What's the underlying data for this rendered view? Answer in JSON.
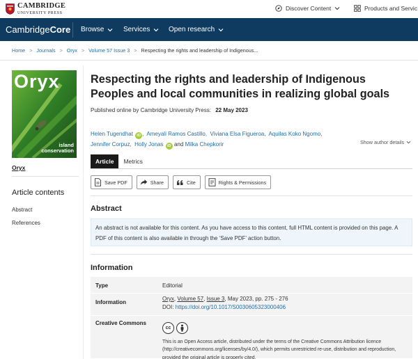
{
  "topbar": {
    "logo_line1": "CAMBRIDGE",
    "logo_line2": "UNIVERSITY PRESS",
    "discover_label": "Discover Content",
    "products_label": "Products and Servic"
  },
  "navbar": {
    "brand_prefix": "Cambridge",
    "brand_suffix": "Core",
    "items": [
      {
        "label": "Browse"
      },
      {
        "label": "Services"
      },
      {
        "label": "Open research"
      }
    ]
  },
  "breadcrumb": {
    "items": [
      "Home",
      "Journals",
      "Oryx",
      "Volume 57 Issue 3"
    ],
    "current": "Respecting the rights and leadership of Indigenous..."
  },
  "sidebar": {
    "cover_title": "Oryx",
    "cover_sub1": "island",
    "cover_sub2": "conservation",
    "journal_link": "Oryx",
    "contents_heading": "Article contents",
    "contents_items": [
      "Abstract",
      "References"
    ]
  },
  "article": {
    "title": "Respecting the rights and leadership of Indigenous Peoples and local communities in realizing global goals",
    "published_prefix": "Published online by Cambridge University Press:",
    "published_date": "22 May 2023",
    "authors": [
      "Helen Tugendhat",
      "Ameyali Ramos Castillo",
      "Viviana Elsa Figueroa",
      "Aquilas Koko Ngomo",
      "Jennifer Corpuz",
      "Holly Jonas",
      "Milka Chepkorir"
    ],
    "and_word": "and",
    "show_details": "Show author details"
  },
  "tabs": [
    {
      "label": "Article"
    },
    {
      "label": "Metrics"
    }
  ],
  "actions": [
    {
      "label": "Save PDF",
      "icon": "pdf-icon"
    },
    {
      "label": "Share",
      "icon": "share-icon"
    },
    {
      "label": "Cite",
      "icon": "quote-icon"
    },
    {
      "label": "Rights & Permissions",
      "icon": "permissions-icon"
    }
  ],
  "abstract": {
    "heading": "Abstract",
    "notice": "An abstract is not available for this content. As you have access to this content, full HTML content is provided on this page. A PDF of this content is also available in through the ‘Save PDF’ action button."
  },
  "information": {
    "heading": "Information",
    "type_key": "Type",
    "type_val": "Editorial",
    "info_key": "Information",
    "journal": "Oryx",
    "volume": "Volume 57",
    "issue": "Issue 3",
    "date_pages": ", May 2023, pp. 275 - 276",
    "doi_prefix": "DOI:",
    "doi_link": "https://doi.org/10.1017/S0030605323000406",
    "cc_key": "Creative Commons",
    "cc_text": "This is an Open Access article, distributed under the terms of the Creative Commons Attribution licence (http://creativecommons.org/licenses/by/4.0/), which permits unrestricted re-use, distribution and reproduction, provided the original article is properly cited."
  },
  "colors": {
    "navbar": "#0e3b5f",
    "link": "#1f6ea8",
    "orcid": "#a6ce39",
    "notice_bg": "#eef6fb"
  }
}
